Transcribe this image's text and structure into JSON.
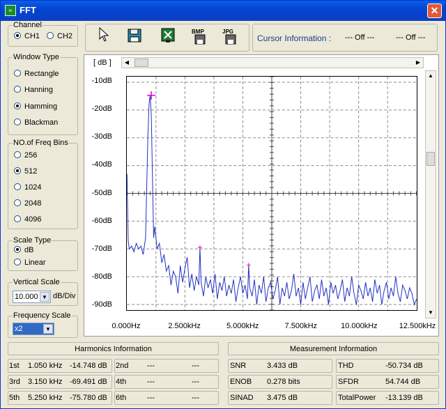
{
  "window": {
    "title": "FFT",
    "icon": "waveform-icon",
    "close_glyph": "✕"
  },
  "channel": {
    "title": "Channel",
    "options": [
      "CH1",
      "CH2"
    ],
    "selected": "CH1"
  },
  "window_type": {
    "title": "Window Type",
    "options": [
      "Rectangle",
      "Hanning",
      "Hamming",
      "Blackman"
    ],
    "selected": "Hamming"
  },
  "freq_bins": {
    "title": "NO.of Freq Bins",
    "options": [
      "256",
      "512",
      "1024",
      "2048",
      "4096"
    ],
    "selected": "512"
  },
  "scale_type": {
    "title": "Scale Type",
    "options": [
      "dB",
      "Linear"
    ],
    "selected": "dB"
  },
  "vertical_scale": {
    "title": "Vertical Scale",
    "value": "10.000",
    "unit": "dB/Div"
  },
  "frequency_scale": {
    "title": "Frequency Scale",
    "value": "x2"
  },
  "toolbar": {
    "icons": [
      "pointer-icon",
      "save-icon",
      "excel-export-icon",
      "bmp-export-icon",
      "jpg-export-icon"
    ]
  },
  "cursor_info": {
    "label": "Cursor Information :",
    "value1": "--- Off ---",
    "value2": "--- Off ---"
  },
  "plot": {
    "unit_label": "[ dB ]"
  },
  "chart_data": {
    "type": "line",
    "y_tick_labels": [
      "-10dB",
      "-20dB",
      "-30dB",
      "-40dB",
      "-50dB",
      "-60dB",
      "-70dB",
      "-80dB",
      "-90dB"
    ],
    "x_tick_labels": [
      "0.000Hz",
      "2.500kHz",
      "5.000kHz",
      "7.500kHz",
      "10.000kHz",
      "12.500kHz"
    ],
    "ylim": [
      -92,
      -8
    ],
    "xlim": [
      0,
      12.5
    ],
    "grid": true,
    "x_khz": [
      0,
      0.05,
      0.1,
      0.2,
      0.3,
      0.4,
      0.5,
      0.6,
      0.7,
      0.8,
      0.9,
      0.95,
      1.0,
      1.05,
      1.1,
      1.15,
      1.2,
      1.3,
      1.4,
      1.5,
      1.6,
      1.7,
      1.8,
      1.9,
      2.0,
      2.1,
      2.2,
      2.3,
      2.4,
      2.5,
      2.6,
      2.7,
      2.8,
      2.9,
      3.0,
      3.1,
      3.15,
      3.2,
      3.3,
      3.4,
      3.5,
      3.6,
      3.7,
      3.8,
      3.9,
      4.0,
      4.1,
      4.2,
      4.3,
      4.4,
      4.5,
      4.6,
      4.7,
      4.8,
      4.9,
      5.0,
      5.1,
      5.2,
      5.25,
      5.3,
      5.4,
      5.5,
      5.6,
      5.7,
      5.8,
      5.9,
      6.0,
      6.1,
      6.2,
      6.3,
      6.4,
      6.5,
      6.6,
      6.7,
      6.8,
      6.9,
      7.0,
      7.1,
      7.2,
      7.3,
      7.4,
      7.5,
      7.6,
      7.7,
      7.8,
      7.9,
      8.0,
      8.1,
      8.2,
      8.3,
      8.4,
      8.5,
      8.6,
      8.7,
      8.8,
      8.9,
      9.0,
      9.1,
      9.2,
      9.3,
      9.4,
      9.5,
      9.6,
      9.7,
      9.8,
      9.9,
      10.0,
      10.1,
      10.2,
      10.3,
      10.4,
      10.5,
      10.6,
      10.7,
      10.8,
      10.9,
      11.0,
      11.1,
      11.2,
      11.3,
      11.4,
      11.5,
      11.6,
      11.7,
      11.8,
      11.9,
      12.0,
      12.1,
      12.2,
      12.3,
      12.4,
      12.5
    ],
    "y_db": [
      -43,
      -67,
      -70,
      -69,
      -71,
      -68,
      -70,
      -69,
      -72,
      -66,
      -30,
      -18,
      -14.7,
      -22,
      -45,
      -66,
      -62,
      -70,
      -68,
      -75,
      -72,
      -78,
      -76,
      -83,
      -78,
      -80,
      -86,
      -76,
      -82,
      -77,
      -73,
      -84,
      -79,
      -85,
      -80,
      -83,
      -69.5,
      -82,
      -87,
      -80,
      -84,
      -81,
      -86,
      -79,
      -88,
      -82,
      -85,
      -80,
      -87,
      -83,
      -86,
      -81,
      -89,
      -84,
      -80,
      -86,
      -83,
      -88,
      -75.8,
      -84,
      -87,
      -81,
      -90,
      -83,
      -86,
      -80,
      -89,
      -84,
      -82,
      -88,
      -85,
      -80,
      -90,
      -84,
      -87,
      -82,
      -88,
      -85,
      -79,
      -87,
      -84,
      -90,
      -82,
      -88,
      -84,
      -80,
      -89,
      -85,
      -83,
      -88,
      -81,
      -87,
      -84,
      -90,
      -82,
      -86,
      -83,
      -88,
      -85,
      -81,
      -89,
      -84,
      -87,
      -80,
      -86,
      -90,
      -83,
      -85,
      -88,
      -82,
      -87,
      -84,
      -89,
      -81,
      -86,
      -83,
      -90,
      -85,
      -82,
      -88,
      -84,
      -87,
      -80,
      -86,
      -89,
      -83,
      -85,
      -88,
      -84,
      -86,
      -90,
      -88
    ],
    "markers": [
      {
        "x": 1.05,
        "y": -14.748,
        "style": "large"
      },
      {
        "x": 3.15,
        "y": -69.491,
        "style": "small"
      },
      {
        "x": 5.25,
        "y": -75.78,
        "style": "small"
      }
    ],
    "line_color": "#2030c0",
    "marker_color": "#e000d0"
  },
  "harmonics": {
    "title": "Harmonics Information",
    "rows": [
      {
        "n": "1st",
        "freq": "1.050 kHz",
        "db": "-14.748 dB"
      },
      {
        "n": "2nd",
        "freq": "---",
        "db": "---"
      },
      {
        "n": "3rd",
        "freq": "3.150 kHz",
        "db": "-69.491 dB"
      },
      {
        "n": "4th",
        "freq": "---",
        "db": "---"
      },
      {
        "n": "5th",
        "freq": "5.250 kHz",
        "db": "-75.780 dB"
      },
      {
        "n": "6th",
        "freq": "---",
        "db": "---"
      }
    ]
  },
  "measurement": {
    "title": "Measurement Information",
    "rows": [
      {
        "label": "SNR",
        "value": "3.433 dB"
      },
      {
        "label": "THD",
        "value": "-50.734 dB"
      },
      {
        "label": "ENOB",
        "value": "0.278 bits"
      },
      {
        "label": "SFDR",
        "value": "54.744 dB"
      },
      {
        "label": "SINAD",
        "value": "3.475 dB"
      },
      {
        "label": "TotalPower",
        "value": "-13.139 dB"
      }
    ]
  }
}
